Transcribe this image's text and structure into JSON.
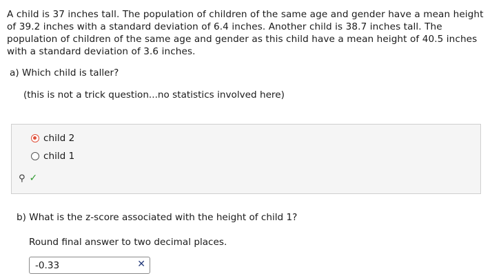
{
  "question": {
    "stem": "A child is 37 inches tall. The population of children of the same age and gender have a mean height of 39.2 inches with a standard deviation of 6.4 inches. Another child is 38.7 inches tall. The population of children of the same age and gender as this child have a mean height of 40.5 inches with a standard deviation of 3.6 inches."
  },
  "part_a": {
    "prompt": "a) Which child is taller?",
    "note": "(this is not a trick question...no statistics involved here)",
    "options": [
      {
        "label": "child 2",
        "selected": true
      },
      {
        "label": "child 1",
        "selected": false
      }
    ],
    "status": "correct"
  },
  "part_b": {
    "prompt": "b) What is the z-score associated with the height of child 1?",
    "instruction": "Round final answer to two decimal places.",
    "answer_value": "-0.33",
    "status": "incorrect"
  },
  "colors": {
    "selected_radio": "#e0503a",
    "correct_check": "#2e9a2e",
    "incorrect_x": "#233a7a"
  }
}
